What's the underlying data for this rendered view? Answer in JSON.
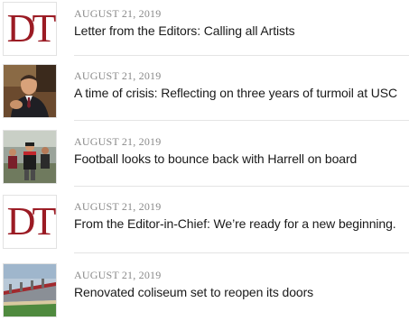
{
  "articles": [
    {
      "date": "AUGUST 21, 2019",
      "title": "Letter from the Editors: Calling all Artists",
      "thumbnail": "dt-logo",
      "logo_text": "DT"
    },
    {
      "date": "AUGUST 21, 2019",
      "title": "A time of crisis: Reflecting on three years of turmoil at USC",
      "thumbnail": "photo-man-in-suit"
    },
    {
      "date": "AUGUST 21, 2019",
      "title": "Football looks to bounce back with Harrell on board",
      "thumbnail": "photo-football-coach"
    },
    {
      "date": "AUGUST 21, 2019",
      "title": "From the Editor-in-Chief: We’re ready for a new beginning.",
      "thumbnail": "dt-logo",
      "logo_text": "DT"
    },
    {
      "date": "AUGUST 21, 2019",
      "title": "Renovated coliseum set to reopen its doors",
      "thumbnail": "photo-coliseum"
    }
  ],
  "colors": {
    "logo": "#9b1b24",
    "date": "#8a8a8a",
    "title": "#1a1a1a",
    "divider": "#e4e4e4"
  }
}
